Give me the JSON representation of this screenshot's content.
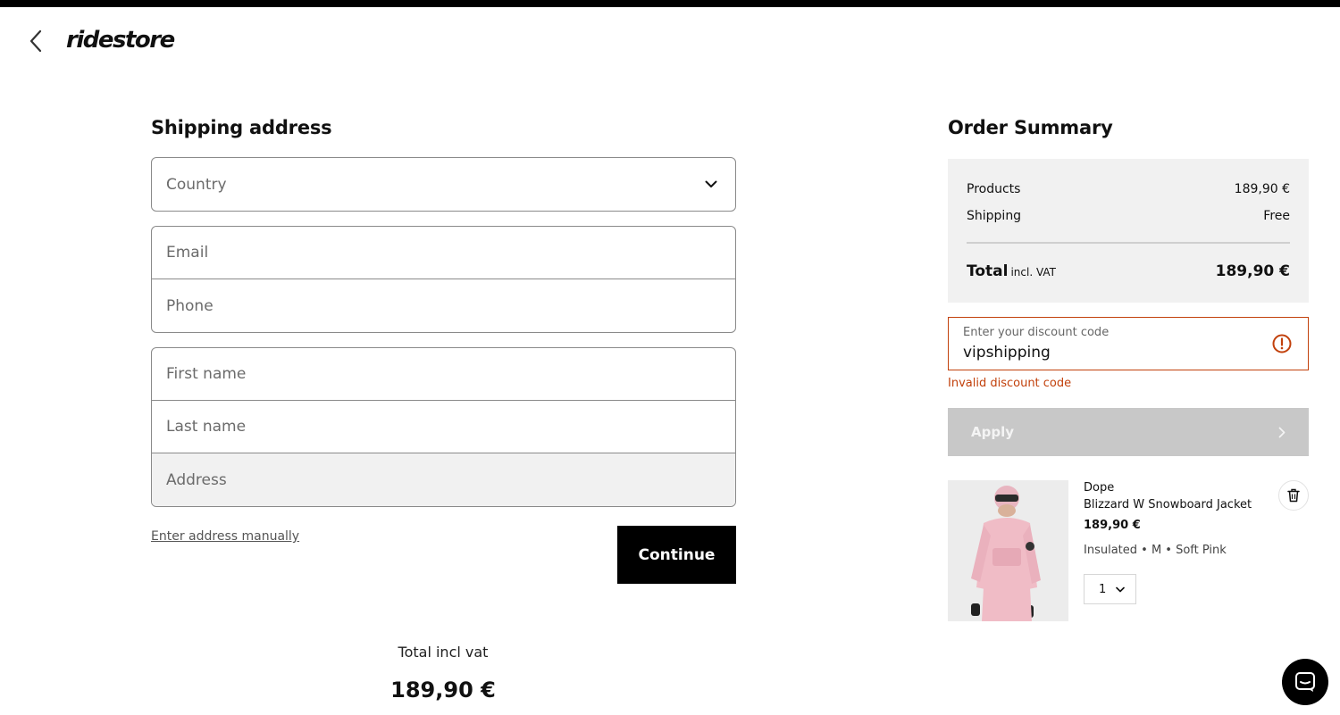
{
  "header": {
    "logo_text": "ridestore",
    "back_icon": "chevron-left-icon"
  },
  "shipping": {
    "title": "Shipping address",
    "country_placeholder": "Country",
    "email_placeholder": "Email",
    "phone_placeholder": "Phone",
    "first_name_placeholder": "First name",
    "last_name_placeholder": "Last name",
    "address_placeholder": "Address",
    "manual_link": "Enter address manually",
    "continue_label": "Continue"
  },
  "bottom_total": {
    "label": "Total incl vat",
    "value": "189,90 €"
  },
  "summary": {
    "title": "Order Summary",
    "products_label": "Products",
    "products_value": "189,90 €",
    "shipping_label": "Shipping",
    "shipping_value": "Free",
    "total_label": "Total",
    "total_vat_label": "incl. VAT",
    "total_value": "189,90 €"
  },
  "discount": {
    "label": "Enter your discount code",
    "value": "vipshipping",
    "error": "Invalid discount code",
    "apply_label": "Apply",
    "error_color": "#c2410c"
  },
  "product": {
    "brand": "Dope",
    "name": "Blizzard W Snowboard Jacket",
    "price": "189,90 €",
    "variant": "Insulated • M • Soft Pink",
    "quantity": "1"
  },
  "colors": {
    "accent": "#000000",
    "summary_bg": "#f1f1f1",
    "apply_disabled": "#c8c8c8"
  }
}
